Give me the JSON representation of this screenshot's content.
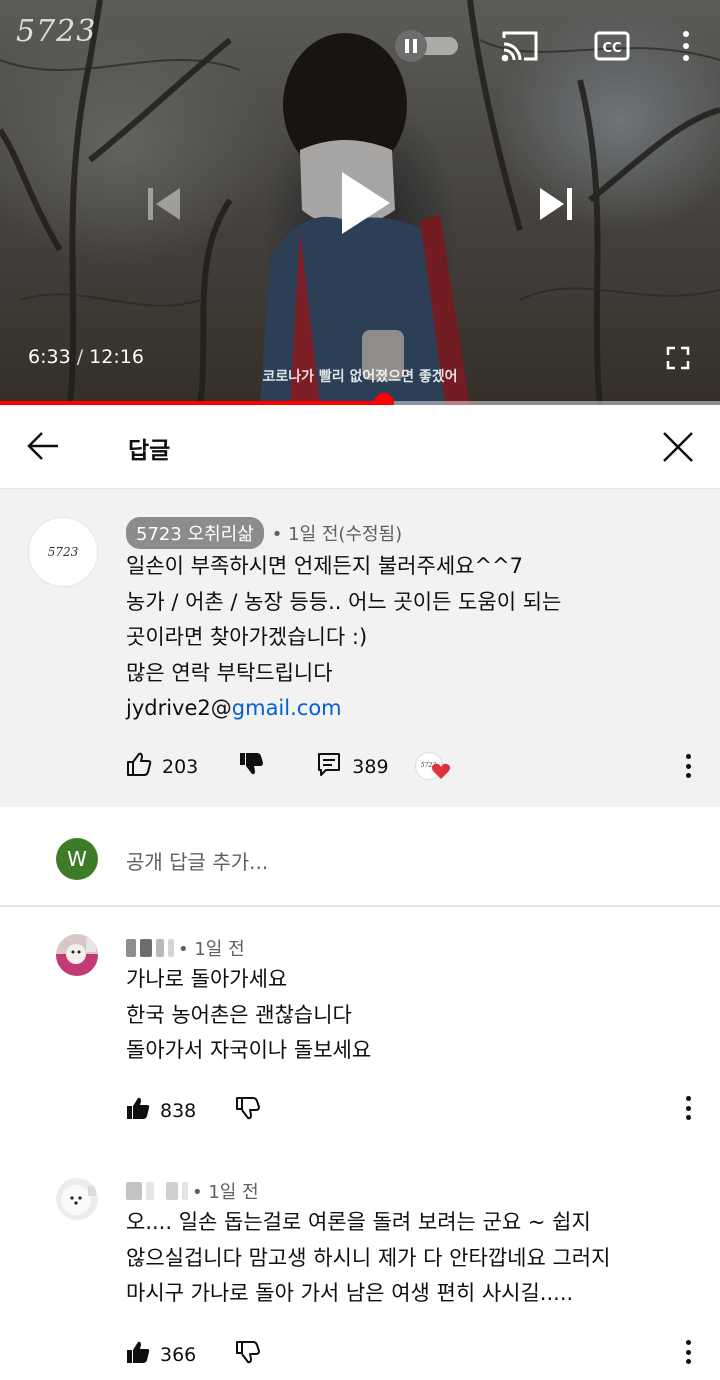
{
  "player": {
    "watermark": "5723",
    "current_time": "6:33",
    "duration": "12:16",
    "subtitle": "코로나가 빨리 없어졌으면 좋겠어",
    "progress": 0.534
  },
  "header": {
    "title": "답글"
  },
  "main_comment": {
    "avatar_text": "5723",
    "author": "5723 오취리삶",
    "meta": "• 1일 전(수정됨)",
    "lines": [
      "일손이 부족하시면 언제든지 불러주세요^^7",
      "농가 / 어촌 / 농장 등등.. 어느 곳이든 도움이 되는",
      "곳이라면 찾아가겠습니다 :)",
      "많은 연락 부탁드립니다"
    ],
    "email_user": "jydrive2@",
    "email_domain": "gmail.com",
    "likes": "203",
    "replies": "389"
  },
  "add_reply": {
    "avatar_letter": "W",
    "placeholder": "공개 답글 추가..."
  },
  "replies": [
    {
      "time": "• 1일 전",
      "lines": [
        "가나로 돌아가세요",
        "한국 농어촌은 괜찮습니다",
        "돌아가서 자국이나 돌보세요"
      ],
      "likes": "838"
    },
    {
      "time": "• 1일 전",
      "lines": [
        "오.... 일손 돕는걸로 여론을 돌려 보려는 군요 ~ 쉽지",
        "않으실겁니다 맘고생 하시니 제가 다 안타깝네요 그러지",
        "마시구 가나로 돌아 가서 남은 여생 편히 사시길....."
      ],
      "likes": "366"
    }
  ],
  "colors": {
    "progress": "#ff0000",
    "link": "#065fd4",
    "heart": "#e0323c",
    "avatar_w": "#3e7b27"
  }
}
